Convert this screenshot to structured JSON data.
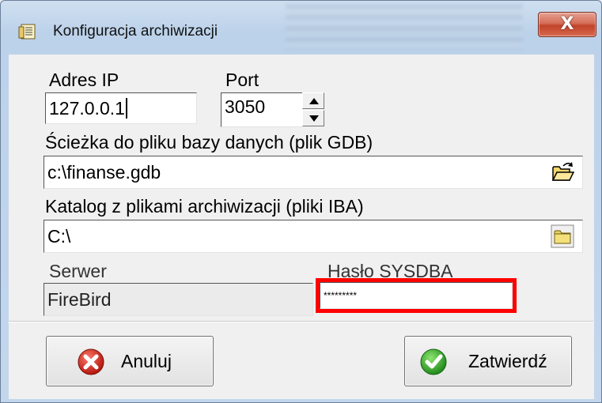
{
  "window": {
    "title": "Konfiguracja archiwizacji",
    "close_label": "X"
  },
  "form": {
    "ip_label": "Adres IP",
    "ip_value": "127.0.0.1",
    "port_label": "Port",
    "port_value": "3050",
    "db_path_label": "Ścieżka do pliku bazy danych (plik GDB)",
    "db_path_value": "c:\\finanse.gdb",
    "archive_dir_label": "Katalog z plikami archiwizacji (pliki IBA)",
    "archive_dir_value": "C:\\",
    "server_label": "Serwer",
    "server_value": "FireBird",
    "password_label": "Hasło SYSDBA",
    "password_value": "*********"
  },
  "buttons": {
    "cancel": "Anuluj",
    "confirm": "Zatwierdź"
  },
  "colors": {
    "highlight": "#ff0000",
    "cancel_icon": "#d9261c",
    "confirm_icon": "#2fa52f"
  },
  "icons": [
    "app-form-icon",
    "spin-up-icon",
    "spin-down-icon",
    "open-folder-icon",
    "folder-icon",
    "cancel-x-icon",
    "confirm-check-icon"
  ]
}
